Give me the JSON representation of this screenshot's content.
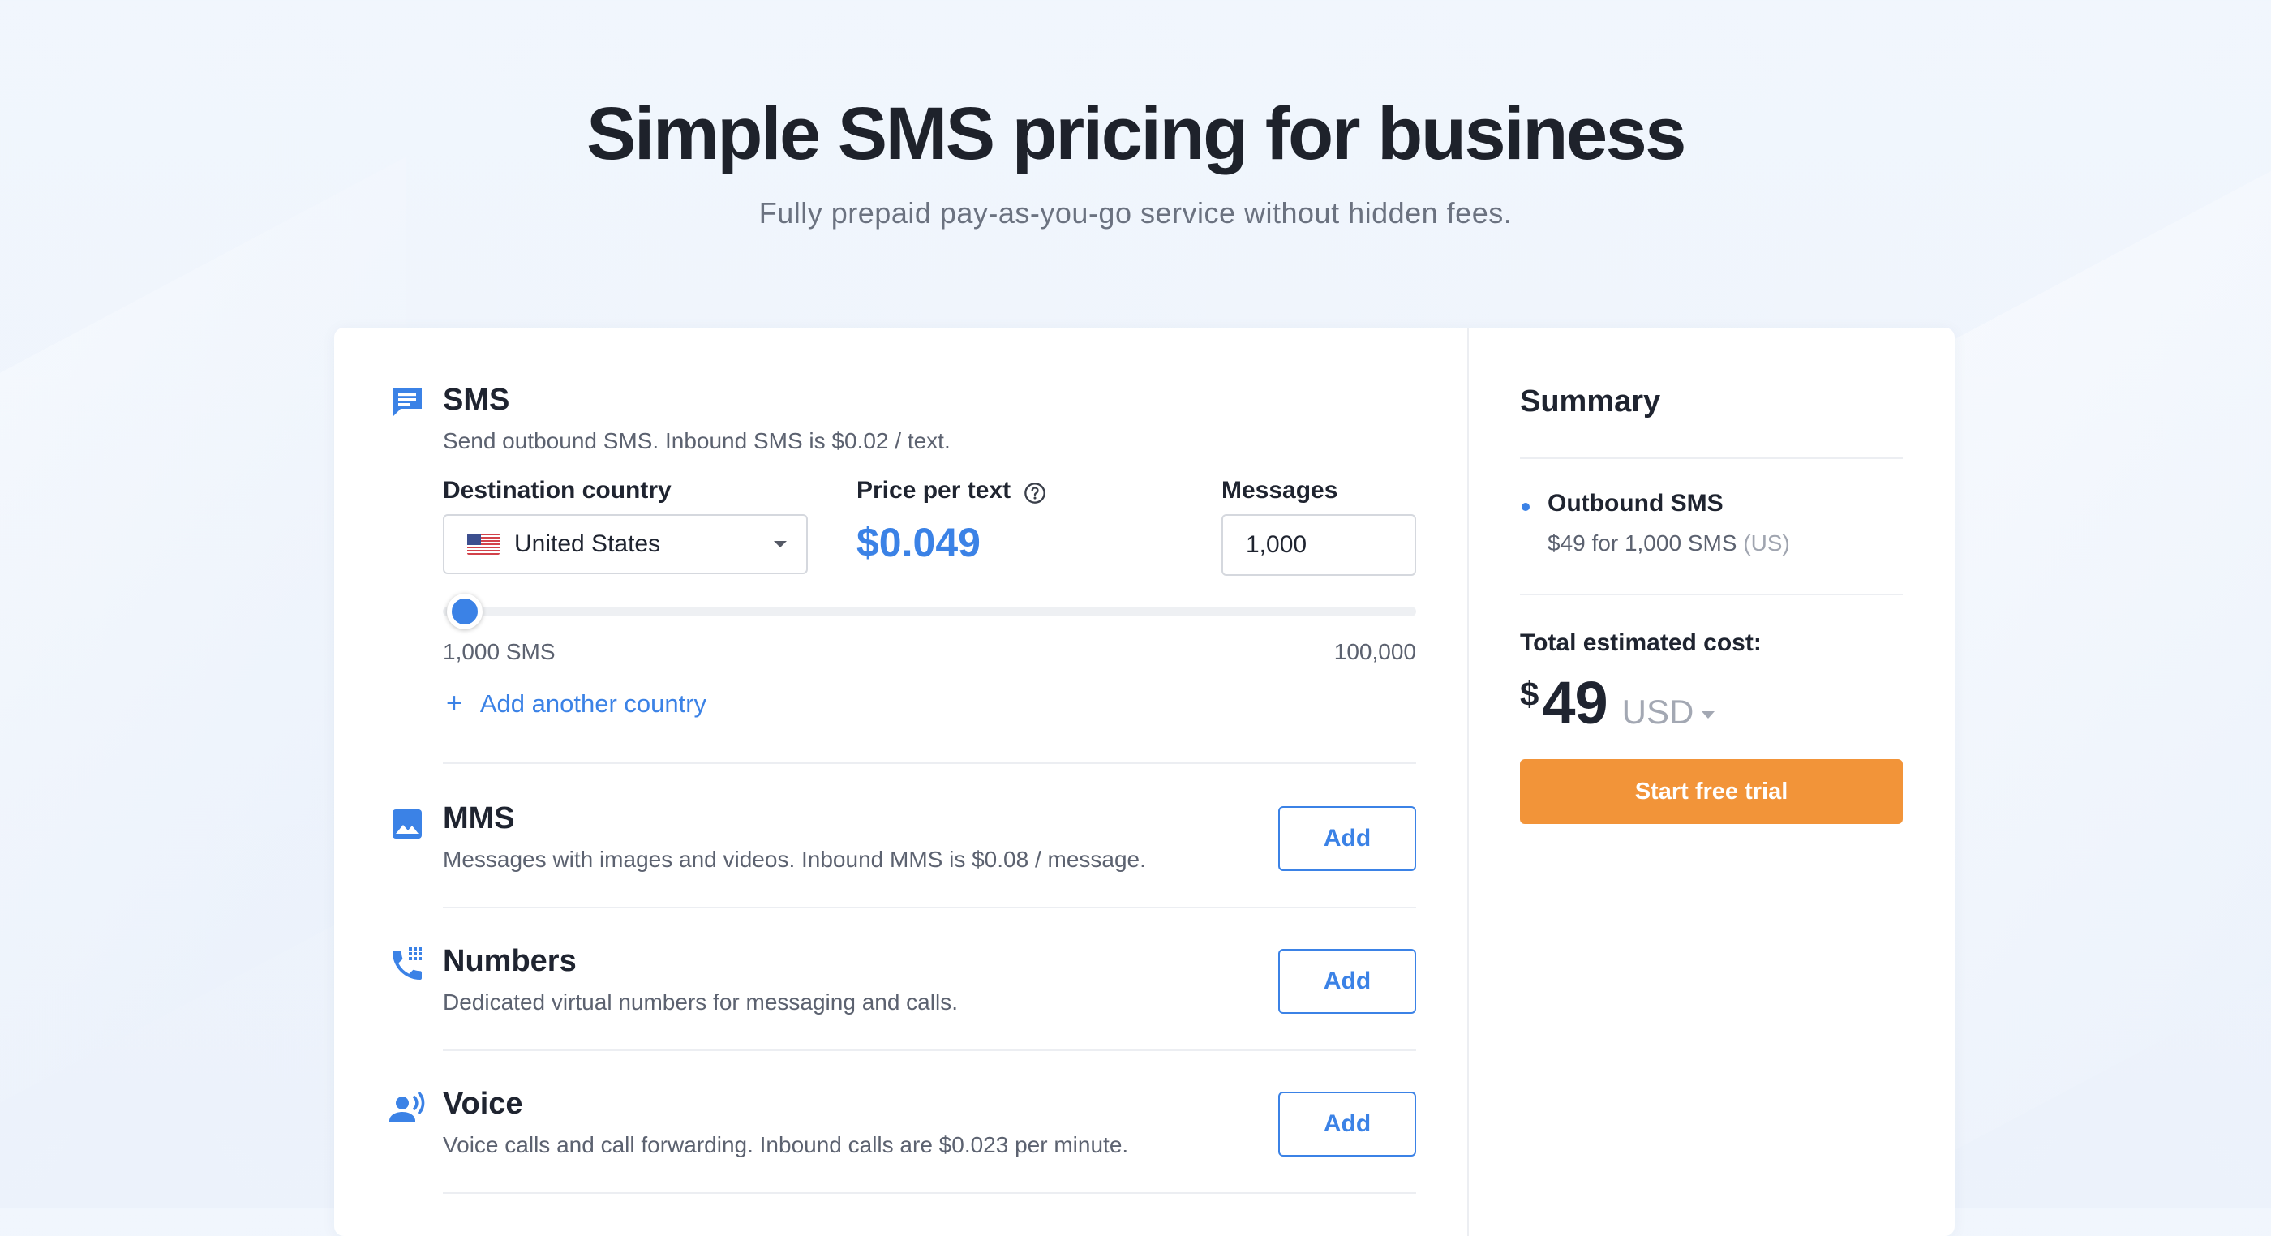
{
  "hero": {
    "title": "Simple SMS pricing for business",
    "subtitle": "Fully prepaid pay-as-you-go service without hidden fees."
  },
  "colors": {
    "accent": "#3b82e6",
    "cta": "#f29439",
    "background": "#eef4fc"
  },
  "sms": {
    "icon": "message-icon",
    "title": "SMS",
    "description": "Send outbound SMS. Inbound SMS is $0.02 / text.",
    "country_label": "Destination country",
    "country_value": "United States",
    "country_flag": "us-flag-icon",
    "price_label": "Price per text",
    "price_value": "$0.049",
    "messages_label": "Messages",
    "messages_value": "1,000",
    "slider_min_label": "1,000 SMS",
    "slider_max_label": "100,000",
    "add_country_label": "Add another country"
  },
  "products": [
    {
      "icon": "image-icon",
      "title": "MMS",
      "description": "Messages with images and videos. Inbound MMS is $0.08 / message.",
      "button": "Add"
    },
    {
      "icon": "phone-dialpad-icon",
      "title": "Numbers",
      "description": "Dedicated virtual numbers for messaging and calls.",
      "button": "Add"
    },
    {
      "icon": "voice-icon",
      "title": "Voice",
      "description": "Voice calls and call forwarding. Inbound calls are $0.023 per minute.",
      "button": "Add"
    }
  ],
  "summary": {
    "title": "Summary",
    "item_title": "Outbound SMS",
    "item_detail": "$49 for 1,000 SMS",
    "item_region": "(US)",
    "total_label": "Total estimated cost:",
    "currency_symbol": "$",
    "total_amount": "49",
    "currency": "USD",
    "cta": "Start free trial"
  }
}
